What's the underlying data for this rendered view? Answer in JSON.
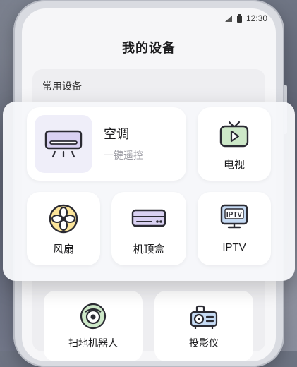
{
  "status_bar": {
    "time": "12:30",
    "icons": [
      "signal-icon",
      "battery-icon"
    ]
  },
  "page": {
    "title": "我的设备"
  },
  "section": {
    "title": "常用设备"
  },
  "devices": {
    "air_conditioner": {
      "name": "空调",
      "subtitle": "一键遥控",
      "icon": "air-conditioner-icon"
    },
    "tv": {
      "name": "电视",
      "icon": "tv-icon"
    },
    "fan": {
      "name": "风扇",
      "icon": "fan-icon"
    },
    "set_top_box": {
      "name": "机顶盒",
      "icon": "set-top-box-icon"
    },
    "iptv": {
      "name": "IPTV",
      "icon": "iptv-icon",
      "icon_text": "IPTV"
    },
    "robot_vacuum": {
      "name": "扫地机器人",
      "icon": "robot-vacuum-icon"
    },
    "projector": {
      "name": "投影仪",
      "icon": "projector-icon"
    }
  },
  "colors": {
    "accent_yellow": "#fbe49a",
    "accent_green": "#cde8c8",
    "accent_purple": "#d9d1f2",
    "accent_blue": "#c6dbf4",
    "icon_stroke": "#2b2b33"
  }
}
